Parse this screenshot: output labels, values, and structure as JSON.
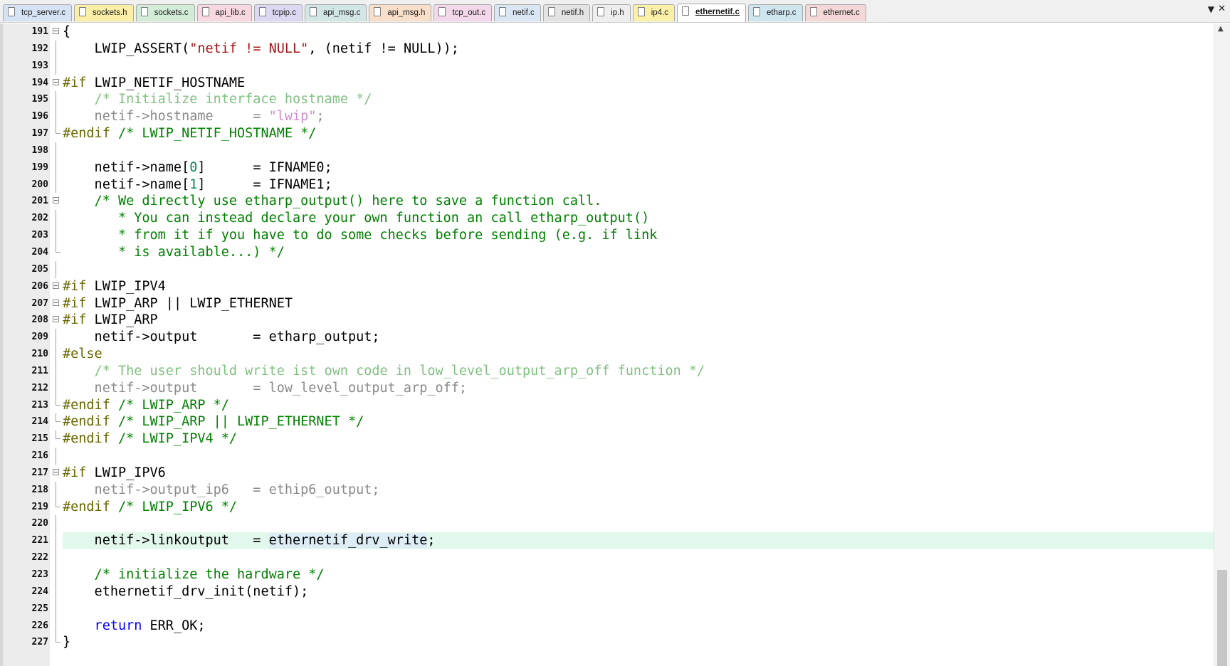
{
  "tabs": [
    {
      "label": "tcp_server.c",
      "color": "#d6e3f5",
      "active": false
    },
    {
      "label": "sockets.h",
      "color": "#fbeea6",
      "active": false
    },
    {
      "label": "sockets.c",
      "color": "#d3ecd8",
      "active": false
    },
    {
      "label": "api_lib.c",
      "color": "#f7d7e0",
      "active": false
    },
    {
      "label": "tcpip.c",
      "color": "#dcd8f2",
      "active": false
    },
    {
      "label": "api_msg.c",
      "color": "#d3e6e6",
      "active": false
    },
    {
      "label": "api_msg.h",
      "color": "#f8dfc9",
      "active": false
    },
    {
      "label": "tcp_out.c",
      "color": "#f2d8ea",
      "active": false
    },
    {
      "label": "netif.c",
      "color": "#dbe6f5",
      "active": false
    },
    {
      "label": "netif.h",
      "color": "#e3e3e3",
      "active": false
    },
    {
      "label": "ip.h",
      "color": "#eeeeee",
      "active": false
    },
    {
      "label": "ip4.c",
      "color": "#fbf0a8",
      "active": false
    },
    {
      "label": "ethernetif.c",
      "color": "#ffffff",
      "active": true
    },
    {
      "label": "etharp.c",
      "color": "#cfe6f0",
      "active": false
    },
    {
      "label": "ethernet.c",
      "color": "#f4d7d7",
      "active": false
    }
  ],
  "tab_menu_icon": "chevron-down-icon",
  "tab_close_icon": "close-icon",
  "lines": [
    {
      "n": "191",
      "fold": "open",
      "t": [
        [
          "",
          "{"
        ]
      ]
    },
    {
      "n": "192",
      "t": [
        [
          "",
          "    LWIP_ASSERT("
        ],
        [
          "str",
          "\"netif != NULL\""
        ],
        [
          "",
          ", (netif != NULL));"
        ]
      ]
    },
    {
      "n": "193",
      "t": []
    },
    {
      "n": "194",
      "fold": "open",
      "t": [
        [
          "dir",
          "#if"
        ],
        [
          "",
          " LWIP_NETIF_HOSTNAME"
        ]
      ]
    },
    {
      "n": "195",
      "t": [
        [
          "discom",
          "    /* Initialize interface hostname */"
        ]
      ]
    },
    {
      "n": "196",
      "t": [
        [
          "dis",
          "    netif->hostname     = "
        ],
        [
          "disstr",
          "\"lwip\""
        ],
        [
          "dis",
          ";"
        ]
      ]
    },
    {
      "n": "197",
      "t": [
        [
          "dir",
          "#endif"
        ],
        [
          "com",
          " /* LWIP_NETIF_HOSTNAME */"
        ]
      ]
    },
    {
      "n": "198",
      "t": []
    },
    {
      "n": "199",
      "t": [
        [
          "",
          "    netif->name["
        ],
        [
          "num",
          "0"
        ],
        [
          "",
          "]      = IFNAME0;"
        ]
      ]
    },
    {
      "n": "200",
      "t": [
        [
          "",
          "    netif->name["
        ],
        [
          "num",
          "1"
        ],
        [
          "",
          "]      = IFNAME1;"
        ]
      ]
    },
    {
      "n": "201",
      "fold": "open",
      "t": [
        [
          "com",
          "    /* We directly use etharp_output() here to save a function call."
        ]
      ]
    },
    {
      "n": "202",
      "t": [
        [
          "com",
          "       * You can instead declare your own function an call etharp_output()"
        ]
      ]
    },
    {
      "n": "203",
      "t": [
        [
          "com",
          "       * from it if you have to do some checks before sending (e.g. if link"
        ]
      ]
    },
    {
      "n": "204",
      "t": [
        [
          "com",
          "       * is available...) */"
        ]
      ]
    },
    {
      "n": "205",
      "t": []
    },
    {
      "n": "206",
      "fold": "open",
      "t": [
        [
          "dir",
          "#if"
        ],
        [
          "",
          " LWIP_IPV4"
        ]
      ]
    },
    {
      "n": "207",
      "fold": "open",
      "t": [
        [
          "dir",
          "#if"
        ],
        [
          "",
          " LWIP_ARP || LWIP_ETHERNET"
        ]
      ]
    },
    {
      "n": "208",
      "fold": "open",
      "t": [
        [
          "dir",
          "#if"
        ],
        [
          "",
          " LWIP_ARP"
        ]
      ]
    },
    {
      "n": "209",
      "t": [
        [
          "",
          "    netif->output       = etharp_output;"
        ]
      ]
    },
    {
      "n": "210",
      "t": [
        [
          "dir",
          "#else"
        ]
      ]
    },
    {
      "n": "211",
      "t": [
        [
          "discom",
          "    /* The user should write ist own code in low_level_output_arp_off function */"
        ]
      ]
    },
    {
      "n": "212",
      "t": [
        [
          "dis",
          "    netif->output       = low_level_output_arp_off;"
        ]
      ]
    },
    {
      "n": "213",
      "t": [
        [
          "dir",
          "#endif"
        ],
        [
          "com",
          " /* LWIP_ARP */"
        ]
      ]
    },
    {
      "n": "214",
      "t": [
        [
          "dir",
          "#endif"
        ],
        [
          "com",
          " /* LWIP_ARP || LWIP_ETHERNET */"
        ]
      ]
    },
    {
      "n": "215",
      "t": [
        [
          "dir",
          "#endif"
        ],
        [
          "com",
          " /* LWIP_IPV4 */"
        ]
      ]
    },
    {
      "n": "216",
      "t": []
    },
    {
      "n": "217",
      "fold": "open",
      "t": [
        [
          "dir",
          "#if"
        ],
        [
          "",
          " LWIP_IPV6"
        ]
      ]
    },
    {
      "n": "218",
      "t": [
        [
          "dis",
          "    netif->output_ip6   = ethip6_output;"
        ]
      ]
    },
    {
      "n": "219",
      "t": [
        [
          "dir",
          "#endif"
        ],
        [
          "com",
          " /* LWIP_IPV6 */"
        ]
      ]
    },
    {
      "n": "220",
      "t": []
    },
    {
      "n": "221",
      "current": true,
      "t": [
        [
          "",
          "    netif->linkoutput   = "
        ],
        [
          "hl",
          "ethernetif_drv_write"
        ],
        [
          "",
          ";"
        ]
      ]
    },
    {
      "n": "222",
      "t": []
    },
    {
      "n": "223",
      "t": [
        [
          "com",
          "    /* initialize the hardware */"
        ]
      ]
    },
    {
      "n": "224",
      "t": [
        [
          "",
          "    ethernetif_drv_init(netif);"
        ]
      ]
    },
    {
      "n": "225",
      "t": []
    },
    {
      "n": "226",
      "t": [
        [
          "kw",
          "    return"
        ],
        [
          "",
          " ERR_OK;"
        ]
      ]
    },
    {
      "n": "227",
      "t": [
        [
          "",
          "}"
        ]
      ]
    }
  ],
  "scroll_up_icon": "scroll-up-arrow-icon"
}
